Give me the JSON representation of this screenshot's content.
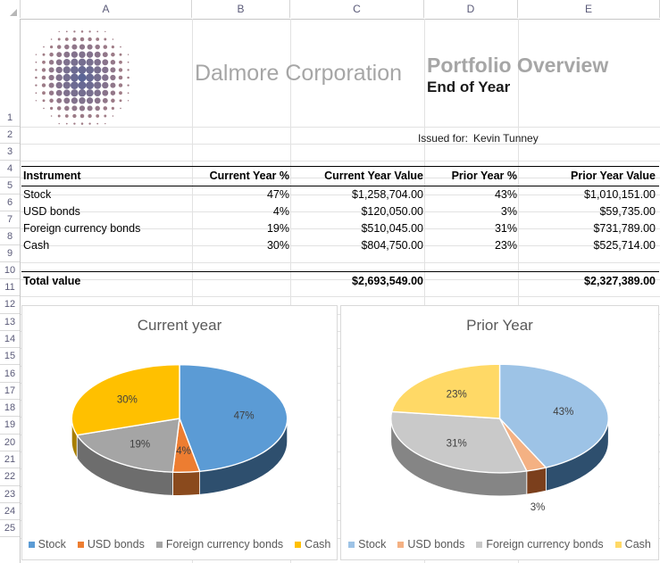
{
  "spreadsheet": {
    "columns": [
      "A",
      "B",
      "C",
      "D",
      "E"
    ],
    "rows": [
      "1",
      "2",
      "3",
      "4",
      "5",
      "6",
      "7",
      "8",
      "9",
      "10",
      "11",
      "12",
      "13",
      "14",
      "15",
      "16",
      "17",
      "18",
      "19",
      "20",
      "21",
      "22",
      "23",
      "24",
      "25"
    ],
    "select_all_icon": "select-all-triangle"
  },
  "header": {
    "logo_name": "dalmore-dot-logo",
    "company": "Dalmore Corporation",
    "title": "Portfolio Overview",
    "subtitle": "End of Year",
    "issued_for_label": "Issued for:",
    "issued_for_value": "Kevin Tunney"
  },
  "table": {
    "columns": [
      "Instrument",
      "Current Year %",
      "Current Year Value",
      "Prior Year %",
      "Prior Year Value"
    ],
    "rows": [
      {
        "instrument": "Stock",
        "current_pct": "47%",
        "current_value": "$1,258,704.00",
        "prior_pct": "43%",
        "prior_value": "$1,010,151.00"
      },
      {
        "instrument": "USD bonds",
        "current_pct": "4%",
        "current_value": "$120,050.00",
        "prior_pct": "3%",
        "prior_value": "$59,735.00"
      },
      {
        "instrument": "Foreign currency bonds",
        "current_pct": "19%",
        "current_value": "$510,045.00",
        "prior_pct": "31%",
        "prior_value": "$731,789.00"
      },
      {
        "instrument": "Cash",
        "current_pct": "30%",
        "current_value": "$804,750.00",
        "prior_pct": "23%",
        "prior_value": "$525,714.00"
      }
    ],
    "total": {
      "label": "Total value",
      "current_pct": "",
      "current_value": "$2,693,549.00",
      "prior_pct": "",
      "prior_value": "$2,327,389.00"
    }
  },
  "chart_data": [
    {
      "type": "pie",
      "title": "Current year",
      "categories": [
        "Stock",
        "USD bonds",
        "Foreign currency bonds",
        "Cash"
      ],
      "values": [
        47,
        4,
        19,
        30
      ],
      "labels": [
        "47%",
        "4%",
        "19%",
        "30%"
      ],
      "colors": [
        "#5B9BD5",
        "#ED7D31",
        "#A5A5A5",
        "#FFC000"
      ],
      "side_colors": [
        "#2E4F6E",
        "#8A4A1D",
        "#6D6D6D",
        "#A87E00"
      ],
      "legend_position": "bottom",
      "three_d": true
    },
    {
      "type": "pie",
      "title": "Prior Year",
      "categories": [
        "Stock",
        "USD bonds",
        "Foreign currency bonds",
        "Cash"
      ],
      "values": [
        43,
        3,
        31,
        23
      ],
      "labels": [
        "43%",
        "3%",
        "31%",
        "23%"
      ],
      "colors": [
        "#9DC3E6",
        "#F4B183",
        "#C9C9C9",
        "#FFD966"
      ],
      "side_colors": [
        "#2E4F6E",
        "#7B3F1C",
        "#858585",
        "#BFA14A"
      ],
      "legend_position": "bottom",
      "three_d": true
    }
  ]
}
